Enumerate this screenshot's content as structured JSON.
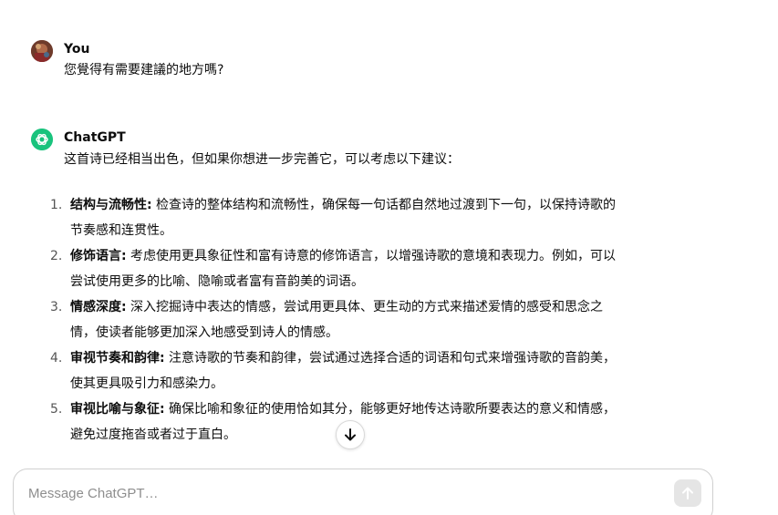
{
  "conversation": {
    "user_message": {
      "author": "You",
      "text": "您覺得有需要建議的地方嗎?"
    },
    "assistant_message": {
      "author": "ChatGPT",
      "intro": "这首诗已经相当出色，但如果你想进一步完善它，可以考虑以下建议：",
      "items": [
        {
          "number": "1.",
          "title": "结构与流畅性:",
          "line1": " 检查诗的整体结构和流畅性，确保每一句话都自然地过渡到下一句，以保持诗歌的",
          "line2": "节奏感和连贯性。"
        },
        {
          "number": "2.",
          "title": "修饰语言:",
          "line1": " 考虑使用更具象征性和富有诗意的修饰语言，以增强诗歌的意境和表现力。例如，可以",
          "line2": "尝试使用更多的比喻、隐喻或者富有音韵美的词语。"
        },
        {
          "number": "3.",
          "title": "情感深度:",
          "line1": " 深入挖掘诗中表达的情感，尝试用更具体、更生动的方式来描述爱情的感受和思念之",
          "line2": "情，使读者能够更加深入地感受到诗人的情感。"
        },
        {
          "number": "4.",
          "title": "审视节奏和韵律:",
          "line1": " 注意诗歌的节奏和韵律，尝试通过选择合适的词语和句式来增强诗歌的音韵美，",
          "line2": "使其更具吸引力和感染力。"
        },
        {
          "number": "5.",
          "title": "审视比喻与象征:",
          "line1": " 确保比喻和象征的使用恰如其分，能够更好地传达诗歌所要表达的意义和情感，",
          "line2": "避免过度拖沓或者过于直白。"
        }
      ]
    }
  },
  "composer": {
    "placeholder": "Message ChatGPT…",
    "value": ""
  },
  "icons": {
    "assistant_avatar": "openai-logo-icon",
    "scroll": "arrow-down-icon",
    "send": "arrow-up-icon"
  },
  "colors": {
    "assistant_avatar_bg": "#19c37d",
    "send_button_bg": "#e5e5e5"
  }
}
